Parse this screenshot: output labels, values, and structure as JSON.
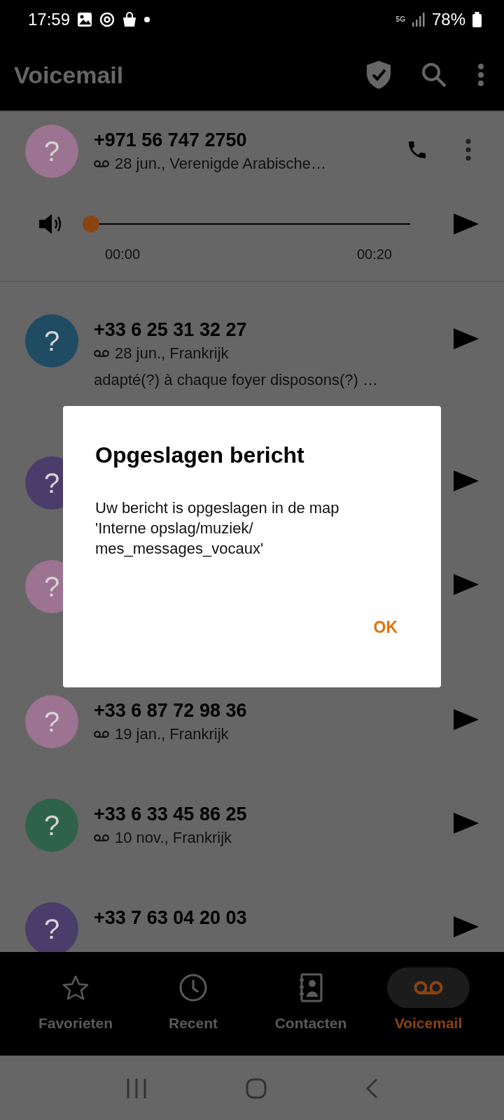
{
  "status_bar": {
    "time": "17:59",
    "network": "5G",
    "battery": "78%"
  },
  "app_bar": {
    "title": "Voicemail"
  },
  "voicemails": [
    {
      "avatar": "?",
      "number": "+971 56 747 2750",
      "detail": "28 jun., Verenigde Arabische…",
      "color": "#9c7390",
      "expanded": true,
      "player": {
        "level": 0,
        "elapsed": "00:00",
        "duration": "00:20"
      }
    },
    {
      "avatar": "?",
      "number": "+33 6 25 31 32 27",
      "detail": "28 jun., Frankrijk",
      "transcript": "adapté(?) à chaque foyer disposons(?) …",
      "color": "#1f4b63",
      "expanded": false
    },
    {
      "avatar": "?",
      "color": "#4b3d6b",
      "expanded": false
    },
    {
      "avatar": "?",
      "color": "#9c7390",
      "expanded": false
    },
    {
      "avatar": "?",
      "number": "+33 6 87 72 98 36",
      "detail": "19 jan., Frankrijk",
      "color": "#9c7390",
      "expanded": false
    },
    {
      "avatar": "?",
      "number": "+33 6 33 45 86 25",
      "detail": "10 nov., Frankrijk",
      "color": "#2f6349",
      "expanded": false
    },
    {
      "avatar": "?",
      "number": "+33 7 63 04 20 03",
      "color": "#4b3d6b",
      "expanded": false
    }
  ],
  "dialog": {
    "title": "Opgeslagen bericht",
    "message": "Uw bericht is opgeslagen in de map\n'Interne opslag/muziek/\nmes_messages_vocaux'",
    "button": "OK"
  },
  "bottom_nav": [
    {
      "label": "Favorieten",
      "kind": "star",
      "selected": false
    },
    {
      "label": "Recent",
      "kind": "clock",
      "selected": false
    },
    {
      "label": "Contacten",
      "kind": "contacts",
      "selected": false
    },
    {
      "label": "Voicemail",
      "kind": "voicemail",
      "selected": true
    }
  ]
}
